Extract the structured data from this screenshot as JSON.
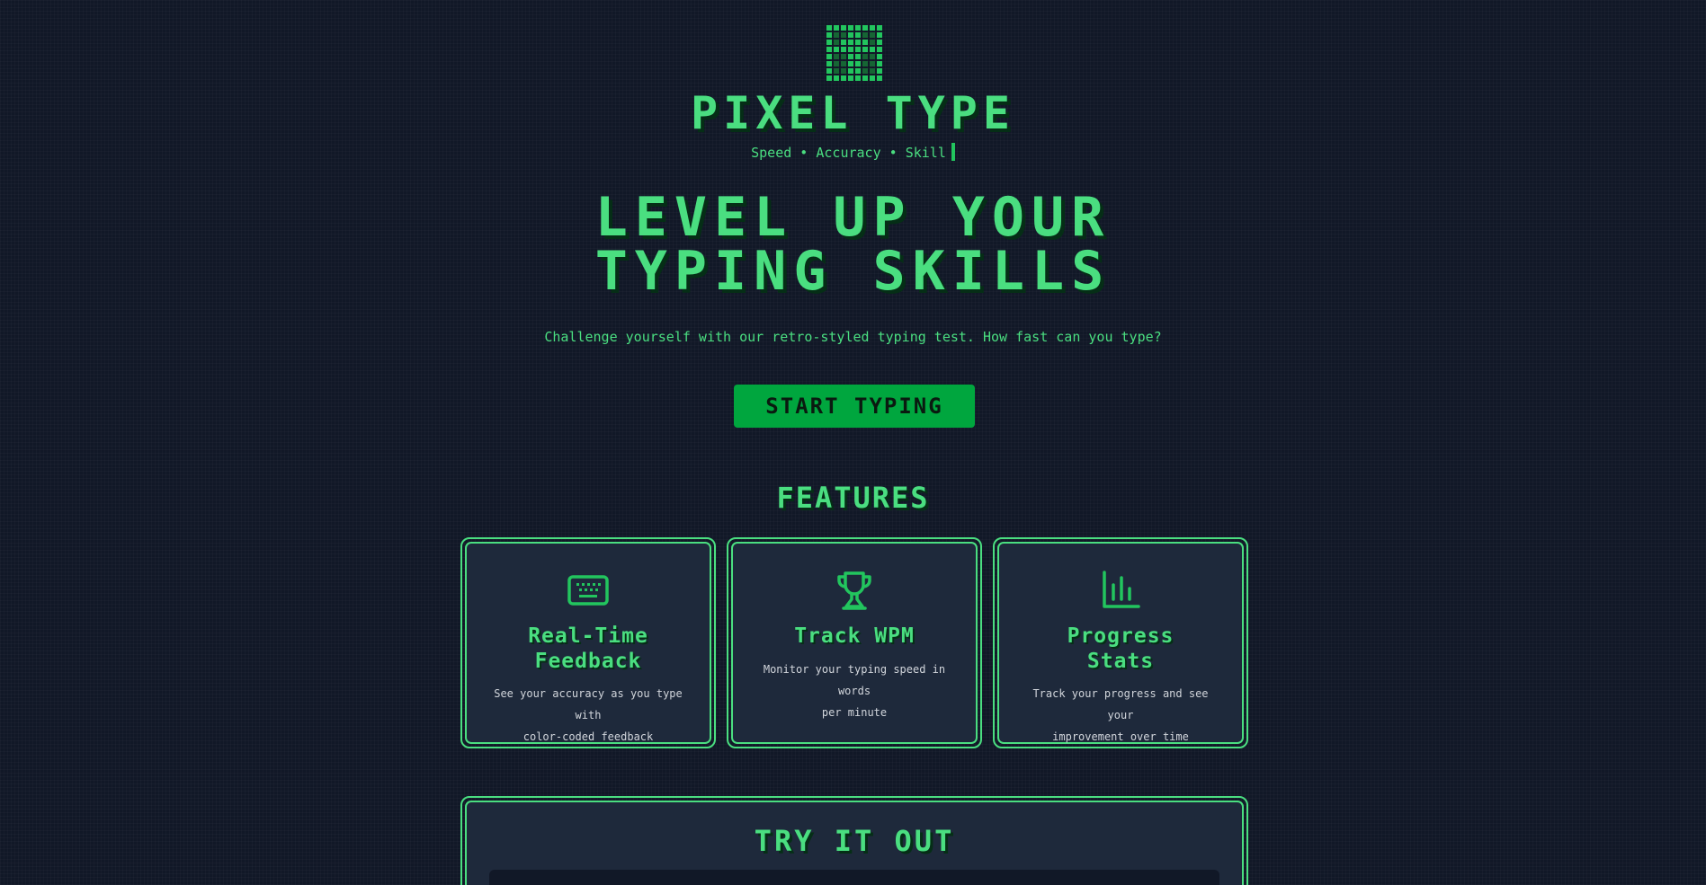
{
  "header": {
    "logo_icon": "pixel-grid-logo-icon",
    "brand": "PIXEL TYPE",
    "tagline": "Speed • Accuracy • Skill"
  },
  "hero": {
    "title_line1": "LEVEL UP YOUR",
    "title_line2": "TYPING SKILLS",
    "subtitle": "Challenge yourself with our retro-styled typing test. How fast can you type?",
    "cta_label": "START TYPING"
  },
  "features": {
    "title": "FEATURES",
    "items": [
      {
        "icon": "keyboard-icon",
        "title_line1": "Real-Time",
        "title_line2": "Feedback",
        "desc_line1": "See your accuracy as you type with",
        "desc_line2": "color-coded feedback"
      },
      {
        "icon": "trophy-icon",
        "title_line1": "Track WPM",
        "title_line2": "",
        "desc_line1": "Monitor your typing speed in words",
        "desc_line2": "per minute"
      },
      {
        "icon": "bar-chart-icon",
        "title_line1": "Progress",
        "title_line2": "Stats",
        "desc_line1": "Track your progress and see your",
        "desc_line2": "improvement over time"
      }
    ]
  },
  "try_it": {
    "title": "TRY IT OUT"
  },
  "colors": {
    "background": "#111827",
    "accent": "#4ade80",
    "button": "#00a63e",
    "card": "#1e293b"
  }
}
